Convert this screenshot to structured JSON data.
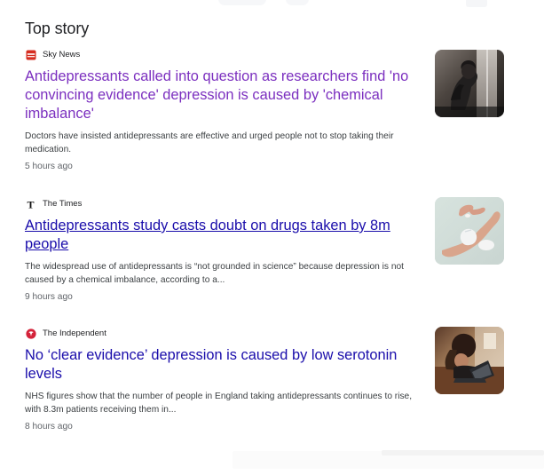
{
  "section": {
    "title": "Top story"
  },
  "stories": [
    {
      "source": "Sky News",
      "source_icon": "sky-news-icon",
      "headline": "Antidepressants called into question as researchers find 'no convincing evidence' depression is caused by 'chemical imbalance'",
      "snippet": "Doctors have insisted antidepressants are effective and urged people not to stop taking their medication.",
      "time": "5 hours ago",
      "thumbnail": "woman-sitting-in-dark-room-image"
    },
    {
      "source": "The Times",
      "source_icon": "the-times-icon",
      "headline": "Antidepressants study casts doubt on drugs taken by 8m people",
      "snippet": "The widespread use of antidepressants is “not grounded in science” because depression is not caused by a chemical imbalance, according to a...",
      "time": "9 hours ago",
      "thumbnail": "hand-holding-pill-image"
    },
    {
      "source": "The Independent",
      "source_icon": "the-independent-icon",
      "headline": "No ‘clear evidence’ depression is caused by low serotonin levels",
      "snippet": "NHS figures show that the number of people in England taking antidepressants continues to rise, with 8.3m patients receiving them in...",
      "time": "8 hours ago",
      "thumbnail": "woman-at-laptop-image"
    }
  ],
  "colors": {
    "visited_link": "#7b2fbf",
    "link": "#1a0dab",
    "text": "#202124",
    "muted": "#5f6368",
    "sky_red": "#d62d20",
    "independent_red": "#d4233a"
  }
}
